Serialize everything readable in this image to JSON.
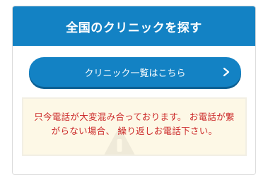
{
  "panel": {
    "title": "全国のクリニックを探す"
  },
  "clinic_list_button": {
    "label": "クリニック一覧はこちら",
    "icon": "chevron-right-icon"
  },
  "notice": {
    "icon": "warning-icon",
    "line1": "只今電話が大変混み合っております。 お電話が繋",
    "line2": "がらない場合、 繰り返しお電話下さい。"
  },
  "colors": {
    "header_bg": "#1382c4",
    "button_bg": "#1382c4",
    "notice_bg": "#fdf8e6",
    "notice_text": "#cc2a2a"
  }
}
